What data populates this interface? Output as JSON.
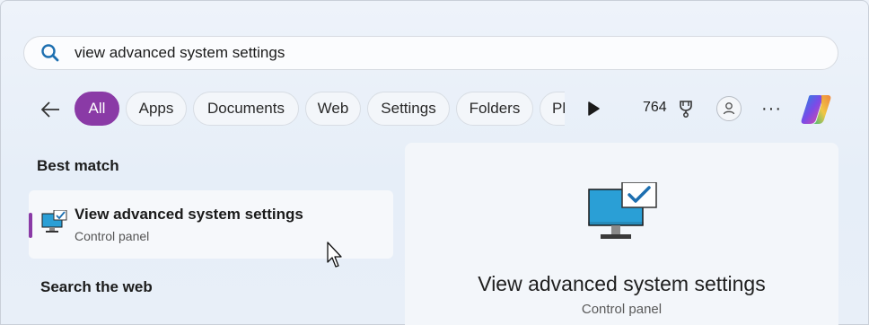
{
  "search": {
    "value": "view advanced system settings"
  },
  "filters": [
    {
      "label": "All",
      "active": true
    },
    {
      "label": "Apps"
    },
    {
      "label": "Documents"
    },
    {
      "label": "Web"
    },
    {
      "label": "Settings"
    },
    {
      "label": "Folders"
    },
    {
      "label": "Ph"
    }
  ],
  "toolbar": {
    "points": "764",
    "more": "···"
  },
  "best_match": {
    "heading": "Best match",
    "title": "View advanced system settings",
    "subtitle": "Control panel"
  },
  "web_heading": "Search the web",
  "preview": {
    "title": "View advanced system settings",
    "subtitle": "Control panel"
  },
  "colors": {
    "accent": "#8a3aa6",
    "search_icon": "#1d6fb0",
    "monitor": "#2a9fd6"
  }
}
